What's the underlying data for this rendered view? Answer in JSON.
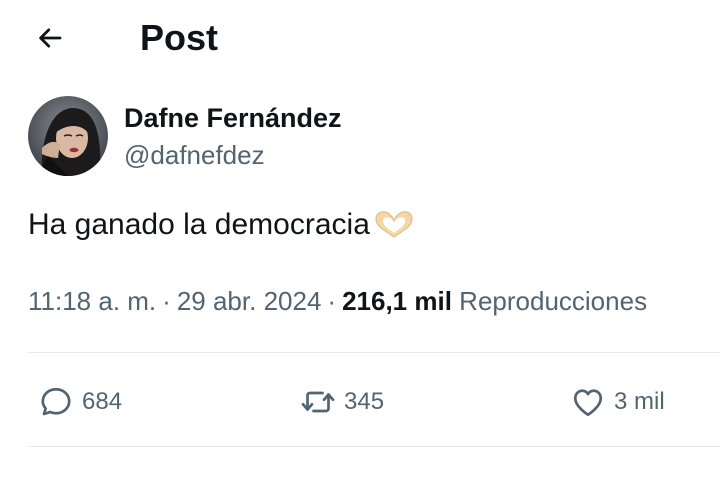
{
  "header": {
    "title": "Post",
    "back_icon": "arrow-left-icon"
  },
  "author": {
    "display_name": "Dafne Fernández",
    "handle": "@dafnefdez"
  },
  "post": {
    "text": "Ha ganado la democracia",
    "emoji_icon": "heart-hands-icon",
    "time": "11:18 a. m.",
    "date": "29 abr. 2024",
    "separator": "·",
    "views_count": "216,1 mil",
    "views_label": "Reproducciones"
  },
  "actions": {
    "replies": {
      "icon": "reply-bubble-icon",
      "count": "684"
    },
    "reposts": {
      "icon": "repost-icon",
      "count": "345"
    },
    "likes": {
      "icon": "heart-icon",
      "count": "3 mil"
    }
  },
  "colors": {
    "text_primary": "#0f1419",
    "text_secondary": "#536471",
    "divider": "#e6e9ec"
  }
}
